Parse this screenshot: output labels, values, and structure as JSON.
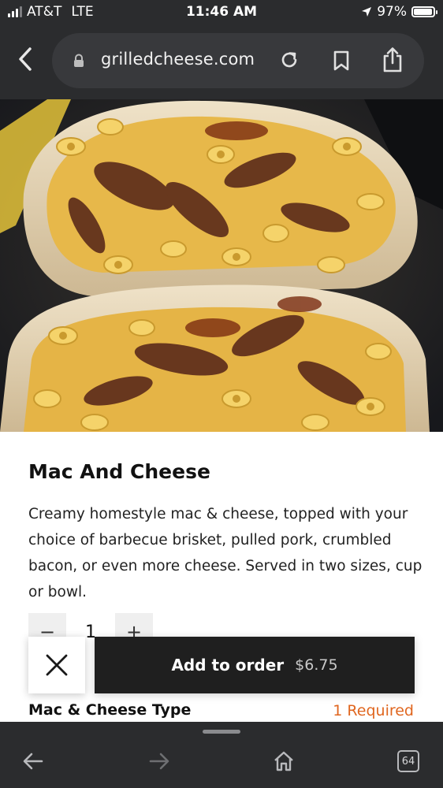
{
  "status_bar": {
    "carrier": "AT&T",
    "network": "LTE",
    "time": "11:46 AM",
    "battery": "97%",
    "battery_level": 0.97,
    "signal_bars": 3
  },
  "browser": {
    "url": "grilledcheese.com",
    "icons": [
      "back-icon",
      "lock-icon",
      "reload-icon",
      "bookmark-icon",
      "share-icon"
    ]
  },
  "item": {
    "name": "Mac And Cheese",
    "description": "Creamy homestyle mac & cheese, topped with your choice of barbecue brisket, pulled pork, crumbled bacon, or even more cheese. Served in two sizes, cup or bowl.",
    "quantity": "1",
    "decrement_symbol": "−",
    "increment_symbol": "+"
  },
  "actions": {
    "add_label": "Add to order",
    "price": "$6.75"
  },
  "options": {
    "title": "Mac & Cheese Type",
    "required_note": "1 Required"
  },
  "toolbar": {
    "tabs_count": "64",
    "icons": [
      "back-arrow-icon",
      "forward-arrow-icon",
      "home-icon",
      "tabs-icon"
    ]
  },
  "colors": {
    "chrome_bg": "#2b2c2e",
    "required_accent": "#e0661f",
    "primary_button": "#1f1f1f"
  }
}
